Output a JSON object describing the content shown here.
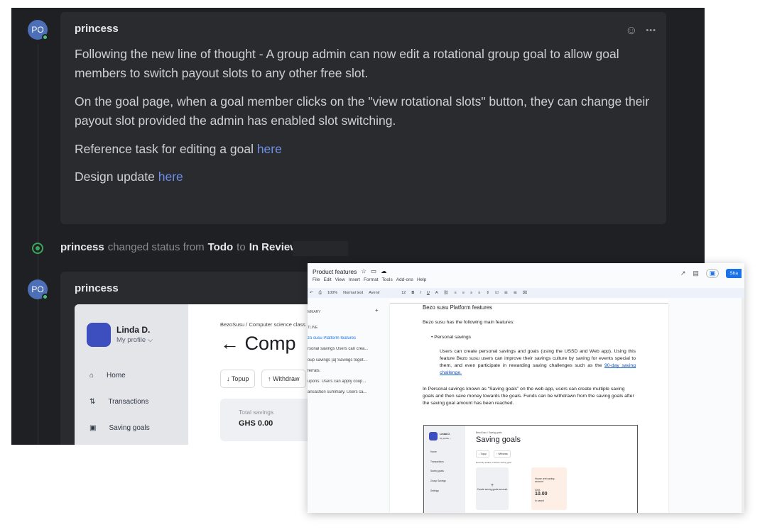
{
  "messages": [
    {
      "avatar": "PO",
      "author": "princess",
      "paragraphs": {
        "p1": "Following the new line of thought - A group admin can now edit a rotational group goal to allow goal members to switch payout slots to any other free slot.",
        "p2": "On the goal page, when a goal member clicks on the \"view rotational slots\" button, they can change their payout slot provided the admin has enabled slot switching.",
        "p3_text": "Reference task for editing a goal ",
        "p3_link": "here",
        "p4_text": "Design update ",
        "p4_link": "here"
      },
      "actions": {
        "emoji": "☺",
        "more": "•••"
      }
    },
    {
      "avatar": "PO",
      "author": "princess"
    }
  ],
  "status_change": {
    "author": "princess",
    "text1": "changed status from",
    "from": "Todo",
    "text2": "to",
    "to": "In Review",
    "end": "."
  },
  "embed": {
    "user_name": "Linda D.",
    "profile_link": "My profile ⌵",
    "nav": [
      "Home",
      "Transactions",
      "Saving goals"
    ],
    "crumb": "BezoSusu / Computer science class",
    "title": "← Comp",
    "buttons": [
      "↓ Topup",
      "↑ Withdraw"
    ],
    "total_label": "Total savings",
    "total_value": "GHS 0.00"
  },
  "gdoc": {
    "doc_title": "Product features",
    "menu": [
      "File",
      "Edit",
      "View",
      "Insert",
      "Format",
      "Tools",
      "Add-ons",
      "Help"
    ],
    "share": "Sha",
    "toolbar": {
      "zoom": "100%",
      "style": "Normal text",
      "font": "Avenir",
      "size": "12",
      "bold": "B",
      "italic": "I",
      "underline": "U",
      "color": "A"
    },
    "outline": {
      "summary": "MMARY",
      "add": "+",
      "outline_label": "TLINE",
      "items": [
        "zo susu Platform features",
        "rsonal savings Users can crea...",
        "oup savings [a] Savings toget...",
        "ferrals.",
        "upons: Users can apply coup...",
        "ansaction summary. Users ca..."
      ]
    },
    "page": {
      "heading": "Bezo susu Platform features",
      "intro": "Bezo susu has the following main features:",
      "bullet": "Personal savings",
      "para1": "Users can create personal savings and goals (using the USSD and Web app). Using this feature Bezo susu users can improve their savings culture by saving for events special to them, and even participate in rewarding saving challenges such as the ",
      "para1_link": "90-day saving challenge.",
      "para2": "In Personal savings known as “Saving goals” on the web app, users can create multiple saving goals and then save money towards the goals. Funds can be withdrawn from the saving goals after the saving goal amount has been reached."
    },
    "mini": {
      "name": "Linda D.",
      "profile": "My profile ⌵",
      "nav": [
        "Home",
        "Transactions",
        "Saving goals",
        "Group Savings",
        "Settings"
      ],
      "crumb": "BezoSusu / Saving goals",
      "title": "Saving goals",
      "buttons": [
        "↓ Topup",
        "↑ Withdraw"
      ],
      "note": "Recently added | Inactive saving goal",
      "create": "Create saving goals account",
      "goal_name": "House rent saving account",
      "goal_label": "GHS",
      "goal_value": "10.00",
      "goal_sub": "In saved"
    }
  },
  "colors": {
    "dark_bg": "#1f2023",
    "card_bg": "#2a2b2f",
    "link": "#6f8fe6",
    "status_green": "#3aa75d",
    "avatar": "#4c6fb8"
  }
}
